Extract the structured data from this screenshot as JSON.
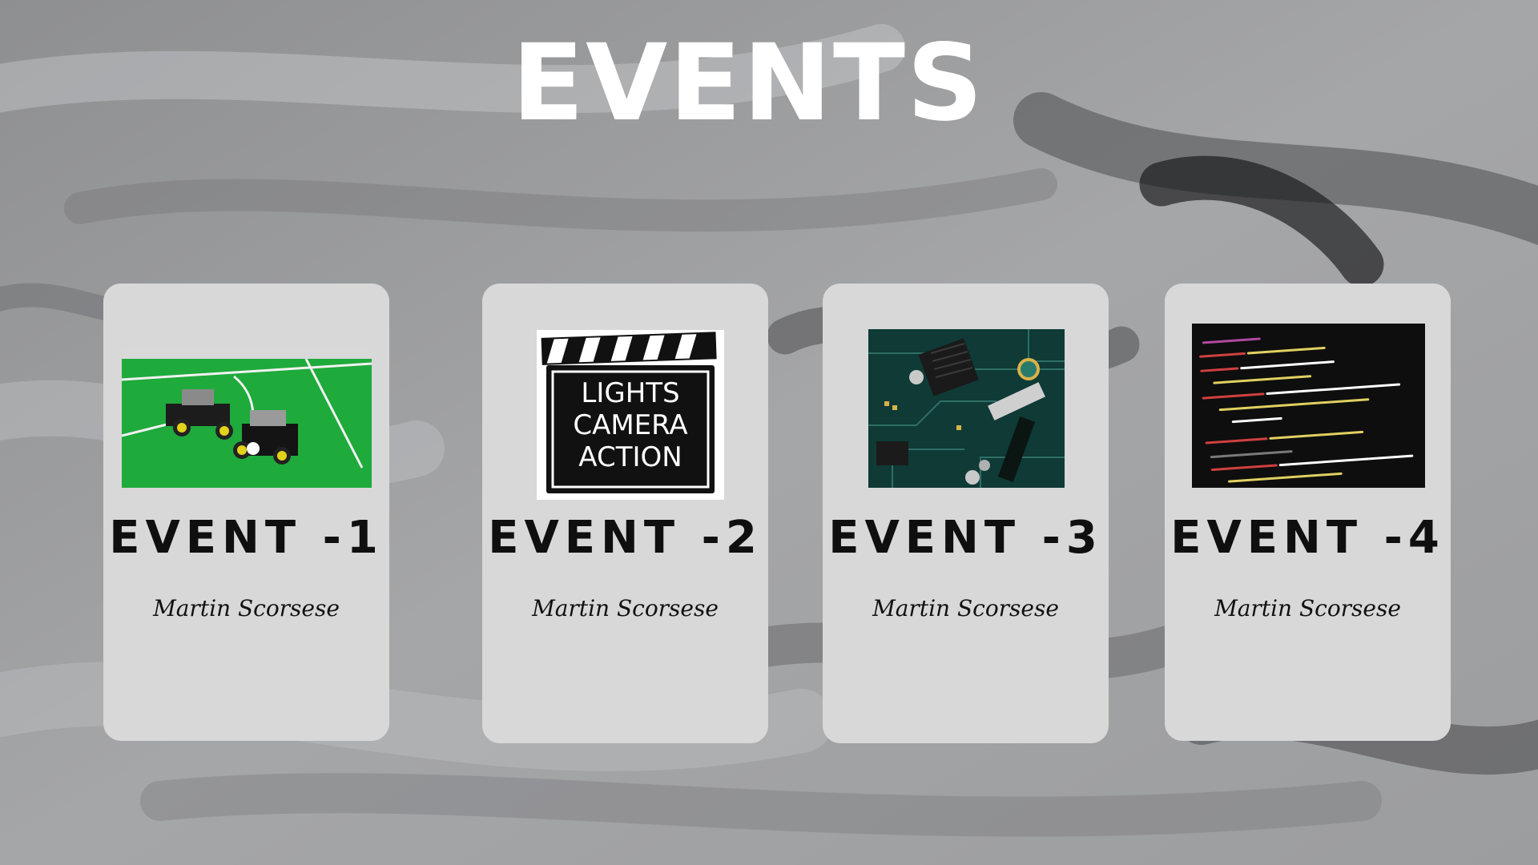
{
  "header": {
    "title": "EVENTS"
  },
  "events": [
    {
      "name": "EVENT -1",
      "subtitle": "Martin Scorsese",
      "image_icon": "robot-soccer-image"
    },
    {
      "name": "EVENT -2",
      "subtitle": "Martin Scorsese",
      "image_icon": "clapperboard-image",
      "image_text": [
        "LIGHTS",
        "CAMERA",
        "ACTION"
      ]
    },
    {
      "name": "EVENT -3",
      "subtitle": "Martin Scorsese",
      "image_icon": "circuit-board-image"
    },
    {
      "name": "EVENT -4",
      "subtitle": "Martin Scorsese",
      "image_icon": "code-screen-image"
    }
  ],
  "colors": {
    "background": "#9a9b9d",
    "card": "#d8d8d8",
    "title": "#ffffff",
    "event_text": "#0f0f0f"
  }
}
